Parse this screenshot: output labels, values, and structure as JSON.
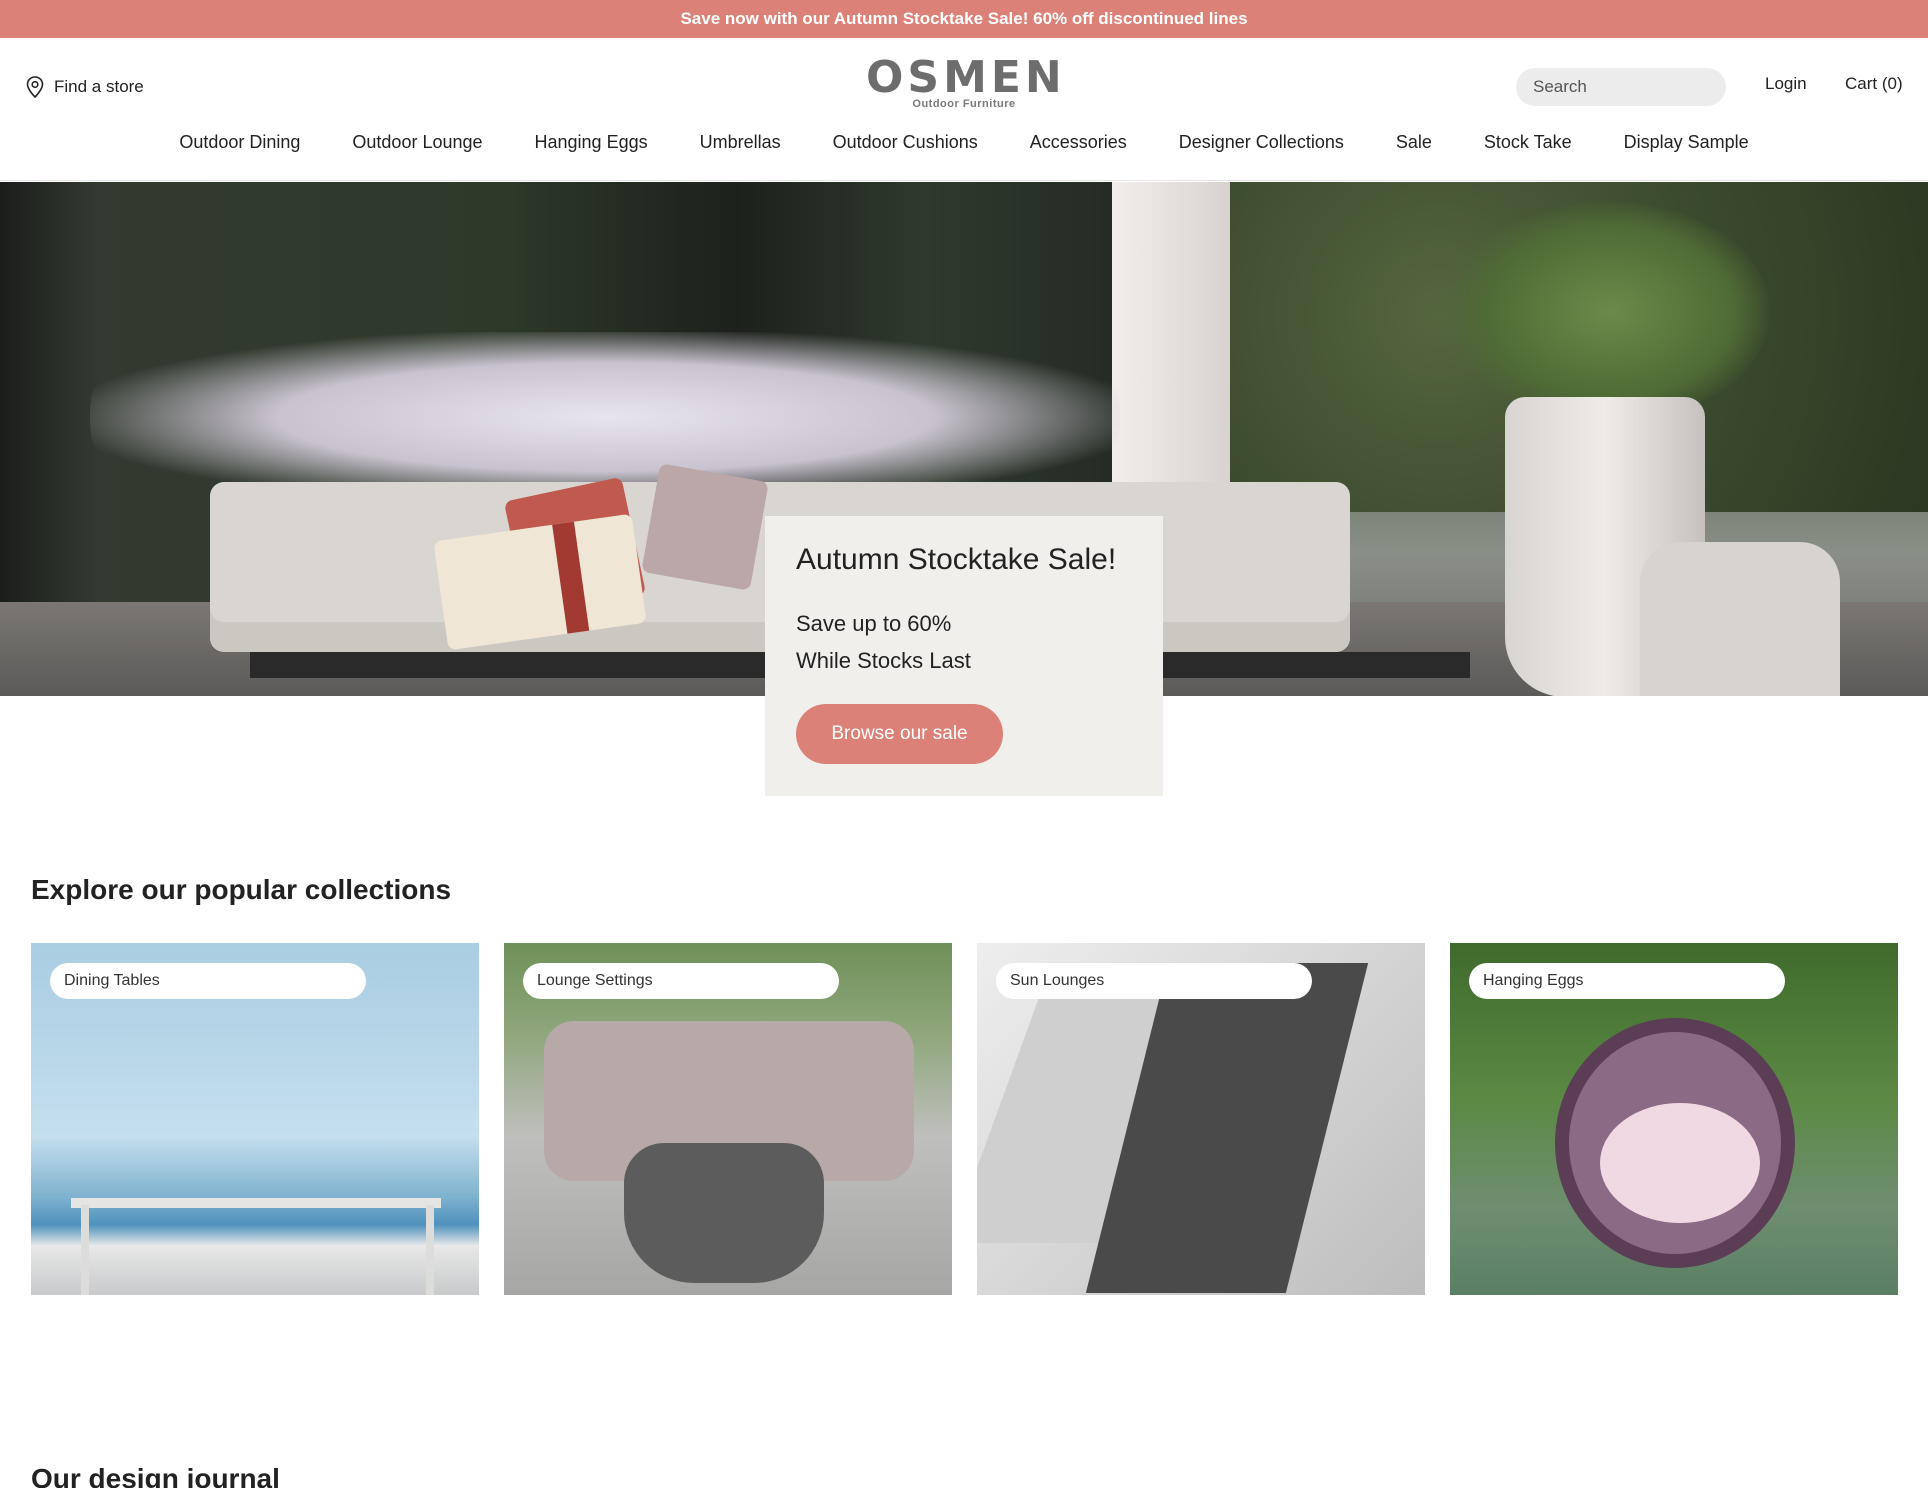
{
  "announcement": "Save now with our Autumn Stocktake Sale! 60% off discontinued lines",
  "header": {
    "find_store": "Find a store",
    "logo_text": "OSMEN",
    "logo_tagline": "Outdoor Furniture",
    "search_placeholder": "Search",
    "login": "Login",
    "cart": "Cart (0)"
  },
  "nav": [
    "Outdoor Dining",
    "Outdoor Lounge",
    "Hanging Eggs",
    "Umbrellas",
    "Outdoor Cushions",
    "Accessories",
    "Designer Collections",
    "Sale",
    "Stock Take",
    "Display Sample"
  ],
  "promo": {
    "title": "Autumn Stocktake Sale!",
    "line1": "Save up to 60%",
    "line2": "While Stocks Last",
    "button": "Browse our sale"
  },
  "collections": {
    "title": "Explore our popular collections",
    "items": [
      "Dining Tables",
      "Lounge Settings",
      "Sun Lounges",
      "Hanging Eggs"
    ]
  },
  "journal": {
    "title": "Our design journal"
  },
  "colors": {
    "accent": "#db8177",
    "promo_bg": "#f0efec"
  }
}
